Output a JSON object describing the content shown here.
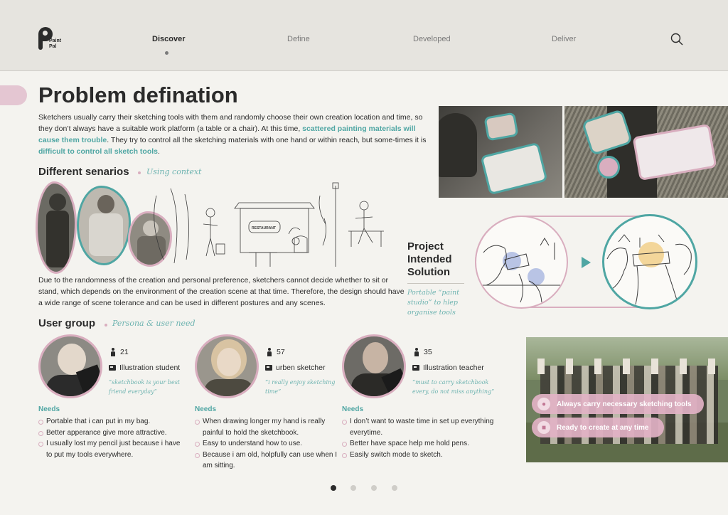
{
  "header": {
    "logo_line1": "Paint",
    "logo_line2": "Pal",
    "nav": [
      "Discover",
      "Define",
      "Developed",
      "Deliver"
    ],
    "active_nav": "Discover",
    "search_icon": "search-icon"
  },
  "page": {
    "title": "Problem defination",
    "intro_part1": "Sketchers usually carry their sketching tools with them and randomly choose their own creation location and time, so they don’t always have a suitable work platform (a table or a chair). At this time, ",
    "intro_hl1": "scattered painting materials will cause them trouble",
    "intro_part2": ". They try to control all the sketching materials with one hand or within reach, but some-times it is ",
    "intro_hl2": "difficult to control all sketch tools",
    "intro_part3": "."
  },
  "scenarios": {
    "heading": "Different senarios",
    "subheading": "Using context",
    "restaurant_sign": "RESTAURANT",
    "description": "Due to the randomness of the creation and personal preference, sketchers cannot decide whether to sit or stand, which depends on the environment of the creation scene at that time. Therefore, the design should have a wide range of scene tolerance and can be used in different postures and any scenes."
  },
  "solution": {
    "title": "Project Intended Solution",
    "subtitle": "Portable “paint studio” to hlep organise tools"
  },
  "user_group": {
    "heading": "User group",
    "subheading": "Persona & user need",
    "needs_label": "Needs",
    "users": [
      {
        "age": "21",
        "role": "Illustration student",
        "quote": "“sketchbook is your best friend everyday”",
        "needs": [
          "Portable that i can put in my bag.",
          "Better apperance give more attractive.",
          "I usually lost my pencil just because i have to put my tools everywhere."
        ]
      },
      {
        "age": "57",
        "role": "urben sketcher",
        "quote": "“i really enjoy sketching time”",
        "needs": [
          "When drawing longer my hand is really painful to hold the sketchbook.",
          "Easy to understand how to use.",
          "Because i am old, holpfully can use when I am sitting."
        ]
      },
      {
        "age": "35",
        "role": "Illustration teacher",
        "quote": "“must to carry sketchbook every, do not miss anything”",
        "needs": [
          "I don’t want to waste time in set up everything everytime.",
          "Better have space help me hold pens.",
          "Easily switch mode to sketch."
        ]
      }
    ]
  },
  "features": [
    {
      "label": "Always carry necessary sketching tools",
      "icon": "palette-icon"
    },
    {
      "label": "Ready to create at any time",
      "icon": "easel-icon"
    }
  ],
  "pagination": {
    "total": 4,
    "current": 1
  },
  "colors": {
    "accent_teal": "#4fa6a3",
    "accent_pink": "#d9aebf",
    "background": "#f4f3ef"
  }
}
